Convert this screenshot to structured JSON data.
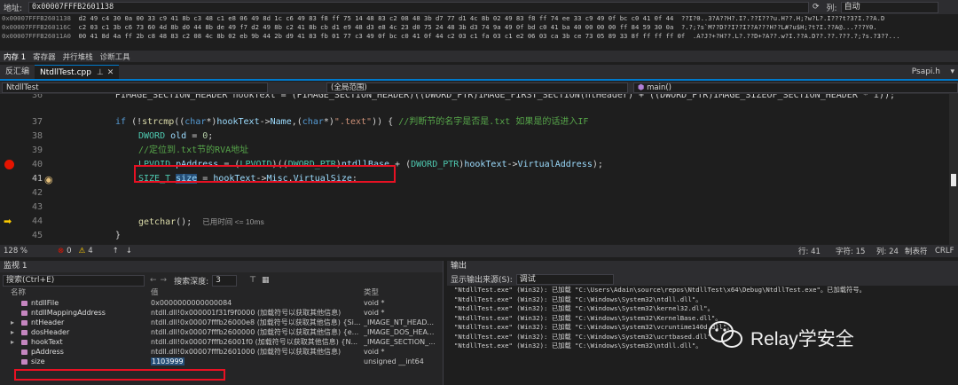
{
  "memory": {
    "address_label": "地址:",
    "address_value": "0x00007FFFB2601138",
    "column_label": "列:",
    "column_value": "自动",
    "lines": [
      {
        "addr": "0x00007FFFB2601138",
        "bytes": "d2 49 c4 30 0a 00 33 c9 41 8b c3 48 c1 e8 06 49 8d 1c c6 49 83 f8 ff 75 14 48 83 c2 08 48 3b d7 77 d1 4c 8b 02 49 83 f8 ff 74 ee 33 c9 49 0f bc c0 41 0f 44",
        "ascii": "??I?0..3?A??H?.I?.??I???u.H??.H;?w?L?.I???t?3?I.??A.D"
      },
      {
        "addr": "0x00007FFFB260116C",
        "bytes": "c2 03 c1 3b c6 73 60 4d 8b d0 44 8b de 49 f7 d2 49 8b c2 41 8b cb d1 e9 48 d3 e8 4c 23 d0 75 24 48 3b d3 74 9a 49 0f bd c0 41 ba 40 00 00 00 ff 84 59 30 0a",
        "ascii": "?.?;?s`M??D??I??I??A???H??L#?u$H;?t?I.??A@...???Y0."
      },
      {
        "addr": "0x00007FFFB26011A0",
        "bytes": "00 41 8d 4a ff 2b c8 48 83 c2 08 4c 8b 02 eb 9b 44 2b d9 41 83 fb 01 77 c3 49 0f bc c0 41 0f 44 c2 03 c1 fa 03 c1 e2 06 03 ca 3b ce 73 05 89 33 8f ff ff ff 0f",
        "ascii": ".A?J?+?H??.L?.??D+?A??.w?I.??A.D??.??.???.?;?s.?3??..."
      }
    ],
    "tabs": [
      "内存 1",
      "寄存器",
      "并行堆栈",
      "诊断工具"
    ]
  },
  "doc_tabs": [
    {
      "label": "反汇编",
      "active": false
    },
    {
      "label": "NtdllTest.cpp",
      "active": true
    }
  ],
  "right_tab": "Psapi.h",
  "nav": {
    "project": "NtdllTest",
    "scope": "(全局范围)",
    "function": "main()"
  },
  "editor": {
    "partial_line": "PIMAGE_SECTION_HEADER hookText = (PIMAGE_SECTION_HEADER)((DWORD_PTR)IMAGE_FIRST_SECTION(ntHeader) + ((DWORD_PTR)IMAGE_SIZEOF_SECTION_HEADER * i));",
    "lines": [
      {
        "num": "37",
        "text": "if (!strcmp((char*)hookText->Name,(char*)\".text\")) { //判断节的名字是否是.txt 如果是的话进入IF"
      },
      {
        "num": "38",
        "text": "DWORD old = 0;"
      },
      {
        "num": "39",
        "text": "//定位到.txt节的RVA地址"
      },
      {
        "num": "40",
        "text": "LPVOID pAddress = (LPVOID)((DWORD_PTR)ntdllBase + (DWORD_PTR)hookText->VirtualAddress);"
      },
      {
        "num": "41",
        "text": "SIZE_T size = hookText->Misc.VirtualSize;"
      },
      {
        "num": "42",
        "text": ""
      },
      {
        "num": "43",
        "text": ""
      },
      {
        "num": "44",
        "text": "getchar();"
      },
      {
        "num": "45",
        "text": "}"
      }
    ],
    "elapsed_hint": "已用时间 <= 10ms"
  },
  "status": {
    "zoom": "128 %",
    "errors": "0",
    "warnings": "4",
    "line": "行: 41",
    "char": "字符: 15",
    "col": "列: 24",
    "tabs": "制表符",
    "eol": "CRLF"
  },
  "watch": {
    "title": "监视 1",
    "search_placeholder": "搜索(Ctrl+E)",
    "depth_label": "搜索深度:",
    "depth_value": "3",
    "headers": {
      "name": "名称",
      "value": "值",
      "type": "类型"
    },
    "rows": [
      {
        "name": "ntdllFile",
        "value": "0x0000000000000084",
        "type": "void *",
        "expand": false
      },
      {
        "name": "ntdllMappingAddress",
        "value": "ntdll.dll!0x000001f31f9f0000 (加载符号以获取其他信息)",
        "type": "void *",
        "expand": false
      },
      {
        "name": "ntHeader",
        "value": "ntdll.dll!0x00007fffb26000e8 (加载符号以获取其他信息) {Si...",
        "type": "_IMAGE_NT_HEAD...",
        "expand": true
      },
      {
        "name": "dosHeader",
        "value": "ntdll.dll!0x00007fffb2600000 (加载符号以获取其他信息) {e...",
        "type": "_IMAGE_DOS_HEA...",
        "expand": true
      },
      {
        "name": "hookText",
        "value": "ntdll.dll!0x00007fffb26001f0 (加载符号以获取其他信息) {N...",
        "type": "_IMAGE_SECTION_...",
        "expand": true
      },
      {
        "name": "pAddress",
        "value": "ntdll.dll!0x00007fffb2601000 (加载符号以获取其他信息)",
        "type": "void *",
        "expand": false
      },
      {
        "name": "size",
        "value": "1103999",
        "type": "unsigned __int64",
        "expand": false
      }
    ]
  },
  "output": {
    "title": "输出",
    "source_label": "显示输出来源(S):",
    "source_value": "调试",
    "lines": [
      "\"NtdllTest.exe\" (Win32): 已加载 \"C:\\Users\\Adain\\source\\repos\\NtdllTest\\x64\\Debug\\NtdllTest.exe\"。已加载符号。",
      "\"NtdllTest.exe\" (Win32): 已加载 \"C:\\Windows\\System32\\ntdll.dll\"。",
      "\"NtdllTest.exe\" (Win32): 已加载 \"C:\\Windows\\System32\\kernel32.dll\"。",
      "\"NtdllTest.exe\" (Win32): 已加载 \"C:\\Windows\\System32\\KernelBase.dll\"。",
      "\"NtdllTest.exe\" (Win32): 已加载 \"C:\\Windows\\System32\\vcruntime140d.dll\"。",
      "\"NtdllTest.exe\" (Win32): 已加载 \"C:\\Windows\\System32\\ucrtbased.dll\"。",
      "\"NtdllTest.exe\" (Win32): 已加载 \"C:\\Windows\\System32\\ntdll.dll\"。"
    ]
  },
  "watermark": "Relay学安全"
}
